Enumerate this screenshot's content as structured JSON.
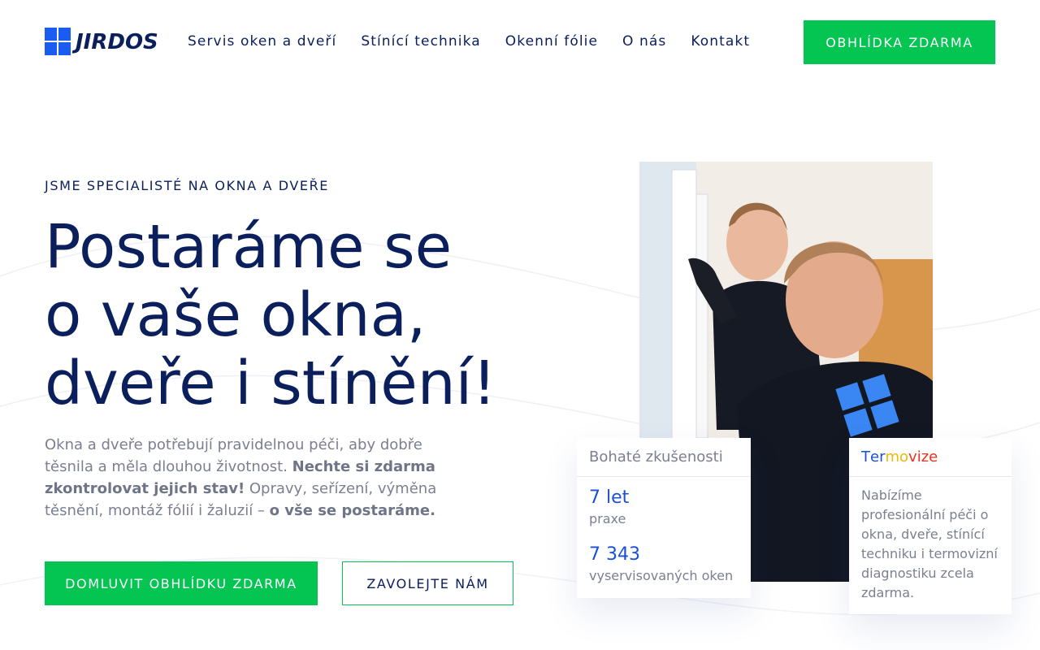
{
  "header": {
    "logo_text": "JIRDOS",
    "nav": [
      {
        "label": "Servis oken a dveří"
      },
      {
        "label": "Stínící technika"
      },
      {
        "label": "Okenní fólie"
      },
      {
        "label": "O nás"
      },
      {
        "label": "Kontakt"
      }
    ],
    "cta_label": "OBHLÍDKA ZDARMA"
  },
  "hero": {
    "eyebrow": "JSME SPECIALISTÉ NA OKNA A DVEŘE",
    "headline_lines": [
      "Postaráme se",
      "o vaše okna,",
      "dveře i stínění!"
    ],
    "lead": {
      "part1": "Okna a dveře potřebují pravidelnou péči, aby dobře těsnila a měla dlouhou životnost. ",
      "bold1": "Nechte si zdarma zkontrolovat jejich stav!",
      "part2": " Opravy, seřízení, výměna těsnění, montáž fólií i žaluzií – ",
      "bold2": "o vše se postaráme."
    },
    "primary_button": "DOMLUVIT OBHLÍDKU ZDARMA",
    "secondary_button": "ZAVOLEJTE NÁM"
  },
  "experience_card": {
    "title": "Bohaté zkušenosti",
    "stats": [
      {
        "value": "7 let",
        "label": "praxe"
      },
      {
        "value": "7 343",
        "label": "vyservisovaných oken"
      }
    ]
  },
  "termo_card": {
    "title_letters": [
      {
        "ch": "T",
        "color": "#1a4fd8"
      },
      {
        "ch": "e",
        "color": "#1a4fd8"
      },
      {
        "ch": "r",
        "color": "#1a4fd8"
      },
      {
        "ch": "m",
        "color": "#f2b705"
      },
      {
        "ch": "o",
        "color": "#f2b705"
      },
      {
        "ch": "v",
        "color": "#e8321e"
      },
      {
        "ch": "i",
        "color": "#e8321e"
      },
      {
        "ch": "z",
        "color": "#e8321e"
      },
      {
        "ch": "e",
        "color": "#e8321e"
      }
    ],
    "body": "Nabízíme profesionální péči o okna, dveře, stínící techniku i termovizní diagnostiku zcela zdarma."
  },
  "colors": {
    "navy": "#0a1f5c",
    "green": "#04c452",
    "blue": "#1a5cf2",
    "muted": "#7a7f92"
  },
  "icons": {
    "logo": "window-grid-logo-icon"
  }
}
